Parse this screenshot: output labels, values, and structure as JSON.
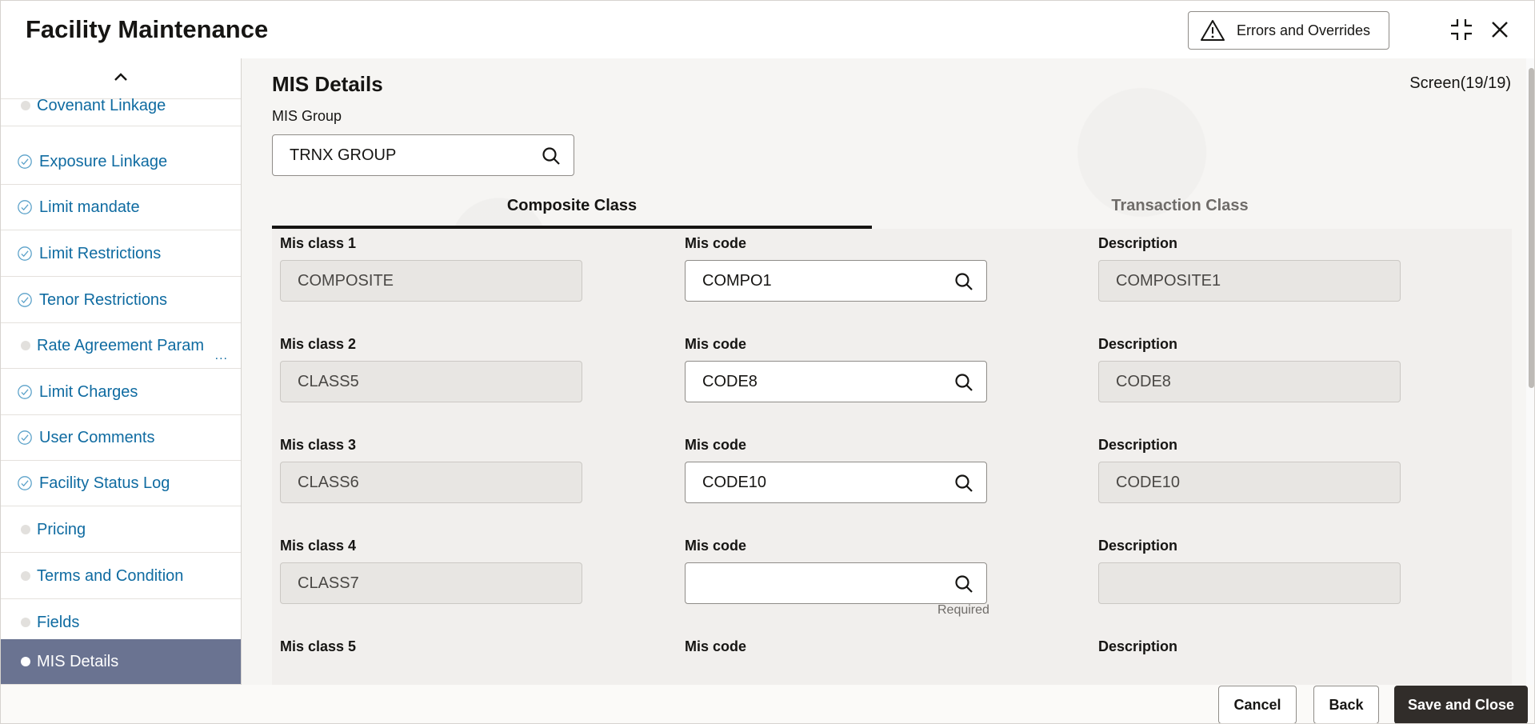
{
  "window": {
    "title": "Facility Maintenance",
    "errors_button": "Errors and Overrides",
    "icons": [
      "warning-icon",
      "minimize-icon",
      "close-icon"
    ]
  },
  "sidebar": {
    "items": [
      {
        "label": "Covenant Linkage",
        "state": "pending"
      },
      {
        "label": "Exposure Linkage",
        "state": "done"
      },
      {
        "label": "Limit mandate",
        "state": "done"
      },
      {
        "label": "Limit Restrictions",
        "state": "done"
      },
      {
        "label": "Tenor Restrictions",
        "state": "done"
      },
      {
        "label": "Rate Agreement Param",
        "state": "pending",
        "more": "..."
      },
      {
        "label": "Limit Charges",
        "state": "done"
      },
      {
        "label": "User Comments",
        "state": "done"
      },
      {
        "label": "Facility Status Log",
        "state": "done"
      },
      {
        "label": "Pricing",
        "state": "pending"
      },
      {
        "label": "Terms and Condition",
        "state": "pending"
      },
      {
        "label": "Fields",
        "state": "pending"
      },
      {
        "label": "MIS Details",
        "state": "active"
      }
    ]
  },
  "main": {
    "section_title": "MIS Details",
    "screen_count": "Screen(19/19)",
    "mis_group": {
      "label": "MIS Group",
      "value": "TRNX GROUP"
    },
    "tabs": [
      {
        "label": "Composite Class",
        "active": true
      },
      {
        "label": "Transaction Class",
        "active": false
      }
    ],
    "rows": [
      {
        "class_label": "Mis class 1",
        "class_value": "COMPOSITE",
        "code_label": "Mis code",
        "code_value": "COMPO1",
        "desc_label": "Description",
        "desc_value": "COMPOSITE1"
      },
      {
        "class_label": "Mis class 2",
        "class_value": "CLASS5",
        "code_label": "Mis code",
        "code_value": "CODE8",
        "desc_label": "Description",
        "desc_value": "CODE8"
      },
      {
        "class_label": "Mis class 3",
        "class_value": "CLASS6",
        "code_label": "Mis code",
        "code_value": "CODE10",
        "desc_label": "Description",
        "desc_value": "CODE10"
      },
      {
        "class_label": "Mis class 4",
        "class_value": "CLASS7",
        "code_label": "Mis code",
        "code_value": "",
        "desc_label": "Description",
        "desc_value": "",
        "hint": "Required"
      },
      {
        "class_label": "Mis class 5",
        "class_value": "",
        "code_label": "Mis code",
        "code_value": "",
        "desc_label": "Description",
        "desc_value": ""
      }
    ]
  },
  "footer": {
    "cancel": "Cancel",
    "back": "Back",
    "save_close": "Save and Close"
  },
  "colors": {
    "link": "#0f6ba1",
    "active_nav": "#6a7391",
    "primary_button": "#312d2a"
  }
}
